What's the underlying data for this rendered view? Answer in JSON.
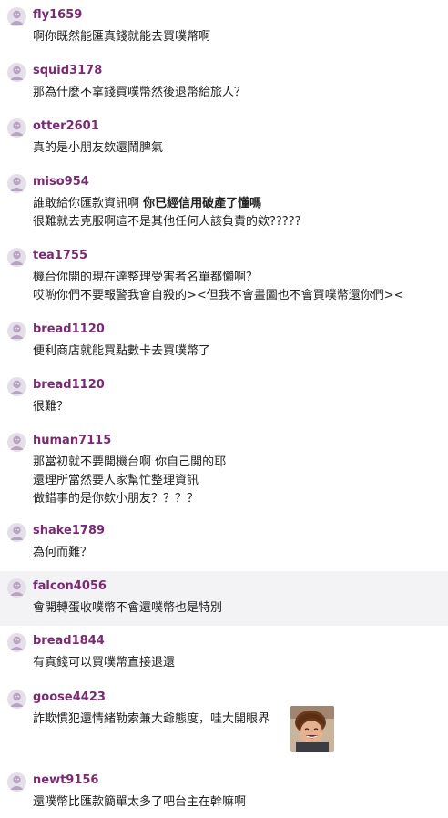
{
  "comments": [
    {
      "user": "fly1659",
      "lines": [
        "啊你既然能匯真錢就能去買噗幣啊"
      ]
    },
    {
      "user": "squid3178",
      "lines": [
        "那為什麼不拿錢買噗幣然後退幣給旅人？"
      ]
    },
    {
      "user": "otter2601",
      "lines": [
        "真的是小朋友欸還鬧脾氣"
      ]
    },
    {
      "user": "miso954",
      "lines": [
        "誰敢給你匯款資訊啊 ",
        "你已經信用破產了懂嗎",
        "很難就去克服啊這不是其他任何人該負責的欸?????"
      ]
    },
    {
      "user": "tea1755",
      "lines": [
        "機台你開的現在達整理受害者名單都懶啊？",
        "哎喲你們不要報警我會自殺的><但我不會畫圖也不會買噗幣還你們><"
      ]
    },
    {
      "user": "bread1120",
      "lines": [
        "便利商店就能買點數卡去買噗幣了"
      ]
    },
    {
      "user": "bread1120",
      "lines": [
        "很難？"
      ]
    },
    {
      "user": "human7115",
      "lines": [
        "那當初就不要開機台啊 你自己開的耶",
        "還理所當然要人家幫忙整理資訊",
        "做錯事的是你欸小朋友？？？？"
      ]
    },
    {
      "user": "shake1789",
      "lines": [
        "為何而難？"
      ]
    },
    {
      "user": "falcon4056",
      "lines": [
        "會開轉蛋收噗幣不會還噗幣也是特別"
      ]
    },
    {
      "user": "bread1844",
      "lines": [
        "有真錢可以買噗幣直接退還"
      ]
    },
    {
      "user": "goose4423",
      "lines": [
        "詐欺慣犯還情緒勒索兼大爺態度，哇大開眼界"
      ]
    },
    {
      "user": "newt9156",
      "lines": [
        "還噗幣比匯款簡單太多了吧台主在幹嘛啊"
      ]
    }
  ],
  "colors": {
    "username": "#7a2a73",
    "highlight_row": "#f3f3f5",
    "text": "#222222"
  },
  "icons": {
    "avatar": "default-avatar-icon",
    "sticker": "laughing-person-sticker"
  }
}
